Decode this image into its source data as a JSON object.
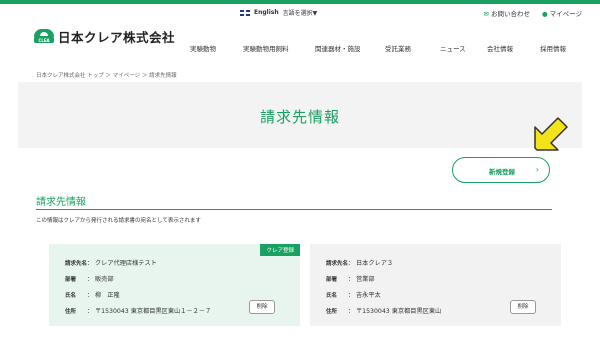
{
  "header": {
    "logo_text": "日本クレア株式会社",
    "logo_sub": "CLEA",
    "lang_label": "English",
    "lang_select": "言語を選択▼",
    "contact": "お問い合わせ",
    "mypage": "マイページ"
  },
  "nav": {
    "items": [
      "実験動物",
      "実験動物用飼料",
      "関連器材・施設",
      "受託業務",
      "ニュース",
      "会社情報",
      "採用情報"
    ]
  },
  "breadcrumb": "日本クレア株式会社 トップ ＞ マイページ ＞ 請求先情報",
  "hero": {
    "title": "請求先情報"
  },
  "actions": {
    "new_label": "新規登録",
    "new_chevron": "›"
  },
  "section": {
    "title": "請求先情報",
    "note": "この情報はクレアから発行される請求書の宛名として表示されます"
  },
  "cards": [
    {
      "badge": "クレア登録",
      "fields": [
        {
          "key": "請求先名",
          "sep": "：",
          "value": "クレア代理店様テスト"
        },
        {
          "key": "部署",
          "sep": "：",
          "value": "販売部"
        },
        {
          "key": "氏名",
          "sep": "：",
          "value": "柳　正隆"
        },
        {
          "key": "住所",
          "sep": "：",
          "value": "〒1530043 東京都目黒区東山１－２－７"
        }
      ],
      "delete_label": "削除"
    },
    {
      "badge": "",
      "fields": [
        {
          "key": "請求先名",
          "sep": "：",
          "value": "日本クレア３"
        },
        {
          "key": "部署",
          "sep": "：",
          "value": "営業部"
        },
        {
          "key": "氏名",
          "sep": "：",
          "value": "吉永平太"
        },
        {
          "key": "住所",
          "sep": "：",
          "value": "〒1530043 東京都目黒区東山"
        }
      ],
      "delete_label": "削除"
    }
  ],
  "colors": {
    "brand": "#1aa061",
    "card_selected": "#e7f5ee",
    "card_default": "#f2f2f2"
  },
  "icons": [
    "mail-icon",
    "person-icon",
    "flag-icon",
    "chevron-right-icon",
    "pointer-arrow-icon"
  ]
}
